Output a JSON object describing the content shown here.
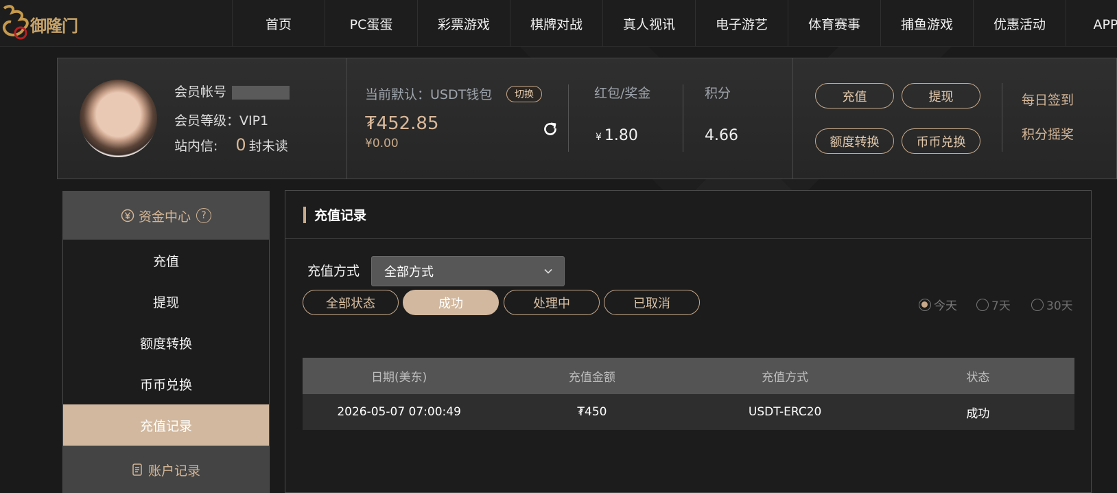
{
  "brand": {
    "logo_text": "御隆门"
  },
  "nav": [
    {
      "label": "首页"
    },
    {
      "label": "PC蛋蛋"
    },
    {
      "label": "彩票游戏"
    },
    {
      "label": "棋牌对战"
    },
    {
      "label": "真人视讯"
    },
    {
      "label": "电子游艺"
    },
    {
      "label": "体育赛事"
    },
    {
      "label": "捕鱼游戏"
    },
    {
      "label": "优惠活动"
    },
    {
      "label": "APP下"
    }
  ],
  "user": {
    "account_label": "会员帐号",
    "level_label": "会员等级：",
    "level_value": "VIP1",
    "inbox_label": "站内信:",
    "unread_count": "0",
    "unread_suffix": "封未读"
  },
  "wallet": {
    "label": "当前默认：USDT钱包",
    "switch_label": "切换",
    "balance": "₮452.85",
    "balance_sub": "¥0.00"
  },
  "stats": {
    "bonus_label": "红包/奖金",
    "bonus_currency": "¥",
    "bonus_value": "1.80",
    "points_label": "积分",
    "points_value": "4.66"
  },
  "actions": {
    "deposit": "充值",
    "withdraw": "提现",
    "transfer": "额度转换",
    "exchange": "币币兑换",
    "daily_signin": "每日签到",
    "points_shake": "积分摇奖"
  },
  "sidebar": {
    "header": "资金中心",
    "header_help": "?",
    "items": [
      {
        "label": "充值"
      },
      {
        "label": "提现"
      },
      {
        "label": "额度转换"
      },
      {
        "label": "币币兑换"
      },
      {
        "label": "充值记录"
      }
    ],
    "footer": "账户记录"
  },
  "main": {
    "title": "充值记录",
    "method_label": "充值方式",
    "method_selected": "全部方式",
    "status_filters": [
      "全部状态",
      "成功",
      "处理中",
      "已取消"
    ],
    "active_status": "成功",
    "ranges": [
      "今天",
      "7天",
      "30天"
    ],
    "active_range": "今天",
    "table": {
      "headers": [
        "日期(美东)",
        "充值金额",
        "充值方式",
        "状态"
      ],
      "rows": [
        [
          "2026-05-07 07:00:49",
          "₮450",
          "USDT-ERC20",
          "成功"
        ]
      ]
    }
  },
  "colors": {
    "accent": "#d2b89e",
    "gold": "#c8a98a"
  }
}
